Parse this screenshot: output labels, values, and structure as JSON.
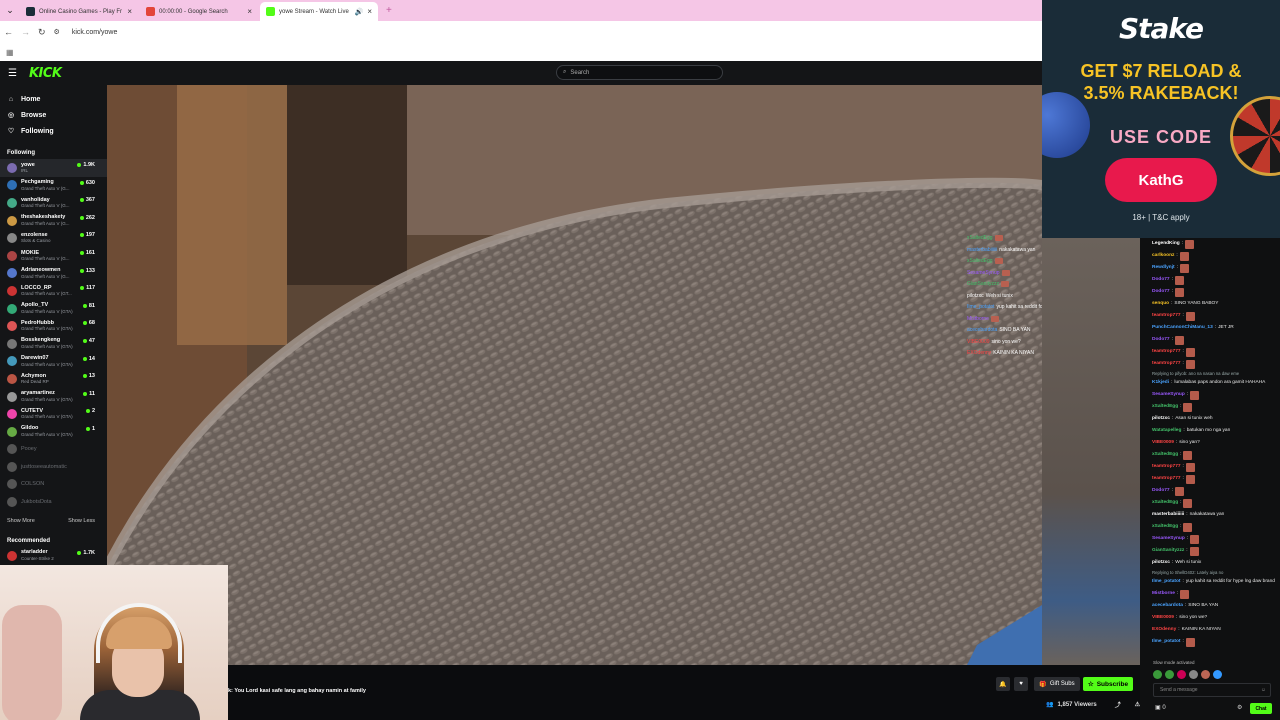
{
  "browser": {
    "tabs": [
      {
        "title": "Online Casino Games - Play Fr",
        "color": "#1b2d39"
      },
      {
        "title": "00:00:00 - Google Search",
        "color": "#e3453a"
      },
      {
        "title": "yowe Stream - Watch Live",
        "color": "#53fc18"
      }
    ],
    "url": "kick.com/yowe",
    "new_tab": "+"
  },
  "header": {
    "logo": "KICK",
    "search_placeholder": "Search"
  },
  "nav": {
    "home": "Home",
    "browse": "Browse",
    "following": "Following"
  },
  "sidebar": {
    "following_title": "Following",
    "channels": [
      {
        "name": "yowe",
        "category": "IRL",
        "viewers": "1.9K",
        "color": "#7b6bb0",
        "online": true
      },
      {
        "name": "Pechgaming",
        "category": "Grand Theft Auto V (G...",
        "viewers": "630",
        "color": "#2e6fb5",
        "online": true
      },
      {
        "name": "vanholiday",
        "category": "Grand Theft Auto V (G...",
        "viewers": "367",
        "color": "#4a8",
        "online": true
      },
      {
        "name": "theshakeshakety",
        "category": "Grand Theft Auto V (G...",
        "viewers": "262",
        "color": "#c94",
        "online": true
      },
      {
        "name": "enzolense",
        "category": "Slots & Casino",
        "viewers": "197",
        "color": "#888",
        "online": true
      },
      {
        "name": "MOKIE",
        "category": "Grand Theft Auto V (G...",
        "viewers": "161",
        "color": "#a44",
        "online": true
      },
      {
        "name": "Adrianeowmen",
        "category": "Grand Theft Auto V (G...",
        "viewers": "133",
        "color": "#57c",
        "online": true
      },
      {
        "name": "LOCCO_RP",
        "category": "Grand Theft Auto V (GT...",
        "viewers": "117",
        "color": "#c33",
        "online": true
      },
      {
        "name": "Apollo_TV",
        "category": "Grand Theft Auto V (GTA)",
        "viewers": "81",
        "color": "#3a7",
        "online": true
      },
      {
        "name": "PedroHubbb",
        "category": "Grand Theft Auto V (GTA)",
        "viewers": "68",
        "color": "#d55",
        "online": true
      },
      {
        "name": "Bosskengkeng",
        "category": "Grand Theft Auto V (GTA)",
        "viewers": "47",
        "color": "#777",
        "online": true
      },
      {
        "name": "Darewin07",
        "category": "Grand Theft Auto V (GTA)",
        "viewers": "14",
        "color": "#49b",
        "online": true
      },
      {
        "name": "Achymon",
        "category": "Red Dead RP",
        "viewers": "13",
        "color": "#b54",
        "online": true
      },
      {
        "name": "aryamartinez",
        "category": "Grand Theft Auto V (GTA)",
        "viewers": "11",
        "color": "#999",
        "online": true
      },
      {
        "name": "CUTETV",
        "category": "Grand Theft Auto V (GTA)",
        "viewers": "2",
        "color": "#e4a",
        "online": true
      },
      {
        "name": "Gildoo",
        "category": "Grand Theft Auto V (GTA)",
        "viewers": "1",
        "color": "#6a4",
        "online": true
      },
      {
        "name": "Pooey",
        "category": "",
        "viewers": "",
        "color": "#555",
        "online": false
      },
      {
        "name": "justtoseeautomatic",
        "category": "",
        "viewers": "",
        "color": "#555",
        "online": false
      },
      {
        "name": "COLSON",
        "category": "",
        "viewers": "",
        "color": "#555",
        "online": false
      },
      {
        "name": "JukbotsDota",
        "category": "",
        "viewers": "",
        "color": "#555",
        "online": false
      }
    ],
    "show_more": "Show More",
    "show_less": "Show Less",
    "recommended_title": "Recommended",
    "recommended": [
      {
        "name": "starladder",
        "category": "Counter-Strike 2",
        "viewers": "1.7K",
        "color": "#c33"
      }
    ]
  },
  "stream": {
    "chat_line": "k: You Lord kasi safe lang ang bahay namin at family",
    "gift_subs": "Gift Subs",
    "subscribe": "Subscribe",
    "viewers": "1,857 Viewers"
  },
  "overlay_chat": [
    {
      "user": "xSaltedEgg",
      "text": "",
      "color": "#43c16a"
    },
    {
      "user": "masterbabiiiiii",
      "text": "nakakatawa yan",
      "color": "#4aa3ff"
    },
    {
      "user": "xSaltedEgg",
      "text": "",
      "color": "#43c16a"
    },
    {
      "user": "SesameSynup",
      "text": "",
      "color": "#9b59ff"
    },
    {
      "user": "GianSanityzzz",
      "text": "",
      "color": "#43c16a"
    },
    {
      "user": "pilotzxc",
      "text": "Weh si tunix",
      "color": "#ffffff"
    },
    {
      "user": "Ilme_potatot",
      "text": "yup kahit sa reddit for hype lng daw brand",
      "color": "#4aa3ff"
    },
    {
      "user": "Mistborne",
      "text": "",
      "color": "#9b59ff"
    },
    {
      "user": "acecebardota",
      "text": "SINO BA YAN",
      "color": "#4aa3ff"
    },
    {
      "user": "VIBE0009",
      "text": "sino yon we?",
      "color": "#ff4444"
    },
    {
      "user": "EXOdenny",
      "text": "KAININ KA NIYAN",
      "color": "#ff4444"
    }
  ],
  "ad": {
    "brand": "Stake",
    "headline_1": "GET $7 RELOAD &",
    "headline_2": "3.5% RAKEBACK!",
    "use_code": "USE CODE",
    "code": "KathG",
    "terms": "18+ | T&C apply"
  },
  "chat": {
    "messages": [
      {
        "user": "LegendKing",
        "text": "",
        "color": "#ffffff",
        "emote": true
      },
      {
        "user": "carlkoonz",
        "text": "",
        "color": "#f7c325",
        "emote": true
      },
      {
        "user": "Rewdlynjt",
        "text": "",
        "color": "#4aa3ff",
        "emote": true
      },
      {
        "user": "Dodo77",
        "text": "",
        "color": "#9b59ff",
        "emote": true
      },
      {
        "user": "Dodo77",
        "text": "",
        "color": "#9b59ff",
        "emote": true
      },
      {
        "user": "senquo",
        "text": "SINO YANG BABOY",
        "color": "#f7c325",
        "emote": false
      },
      {
        "user": "teamtrop777",
        "text": "",
        "color": "#ff4444",
        "emote": true
      },
      {
        "user": "PunchCannonChiManu_13",
        "text": "JET JR",
        "color": "#4aa3ff",
        "emote": false
      },
      {
        "user": "Dodo77",
        "text": "",
        "color": "#9b59ff",
        "emote": true
      },
      {
        "user": "teamtrop777",
        "text": "",
        "color": "#ff4444",
        "emote": true
      },
      {
        "user": "teamtrop777",
        "text": "",
        "color": "#ff4444",
        "emote": true
      },
      {
        "user": "K1kjedi",
        "text": "lumalabas paps andon ara gamit HAHAHA",
        "color": "#4aa3ff",
        "emote": false,
        "reply": "Replying to pifyob: ano na nasan na daw eme"
      },
      {
        "user": "SesameSynup",
        "text": "",
        "color": "#9b59ff",
        "emote": true
      },
      {
        "user": "xSaltedEgg",
        "text": "",
        "color": "#43c16a",
        "emote": true
      },
      {
        "user": "pilotzxc",
        "text": "Asan si tunix weh",
        "color": "#ffffff",
        "emote": false
      },
      {
        "user": "Watatapelleg",
        "text": "batukan mo nga yan",
        "color": "#43c16a",
        "emote": false
      },
      {
        "user": "VIBE0009",
        "text": "sino yan?",
        "color": "#ff4444",
        "emote": false
      },
      {
        "user": "xSaltedEgg",
        "text": "",
        "color": "#43c16a",
        "emote": true
      },
      {
        "user": "teamtrop777",
        "text": "",
        "color": "#ff4444",
        "emote": true
      },
      {
        "user": "teamtrop777",
        "text": "",
        "color": "#ff4444",
        "emote": true
      },
      {
        "user": "Dodo77",
        "text": "",
        "color": "#9b59ff",
        "emote": true
      },
      {
        "user": "xSaltedEgg",
        "text": "",
        "color": "#43c16a",
        "emote": true
      },
      {
        "user": "masterbabiiiiii",
        "text": "nakakatawa yan",
        "color": "#ffffff",
        "emote": false
      },
      {
        "user": "xSaltedEgg",
        "text": "",
        "color": "#43c16a",
        "emote": true
      },
      {
        "user": "SesameSynup",
        "text": "",
        "color": "#9b59ff",
        "emote": true
      },
      {
        "user": "GianSanityzzz",
        "text": "",
        "color": "#43c16a",
        "emote": true
      },
      {
        "user": "pilotzxc",
        "text": "Weh si tunix",
        "color": "#ffffff",
        "emote": false
      },
      {
        "user": "Ilme_potatot",
        "text": "yup kahit sa reddit for hype lng daw brand",
        "color": "#4aa3ff",
        "emote": false,
        "reply": "Replying to ShellD402: Lately aiya no"
      },
      {
        "user": "Mistborne",
        "text": "",
        "color": "#9b59ff",
        "emote": true
      },
      {
        "user": "acecebardota",
        "text": "SINO BA YAN",
        "color": "#4aa3ff",
        "emote": false
      },
      {
        "user": "VIBE0009",
        "text": "sino yon we?",
        "color": "#ff4444",
        "emote": false
      },
      {
        "user": "EXOdenny",
        "text": "KAININ KA NIYAN",
        "color": "#ff4444",
        "emote": false
      },
      {
        "user": "Ilme_potatot",
        "text": "",
        "color": "#4aa3ff",
        "emote": true
      }
    ],
    "slow_mode": "Slow mode activated",
    "input_placeholder": "Send a message",
    "points": "0",
    "chat_button": "Chat"
  }
}
